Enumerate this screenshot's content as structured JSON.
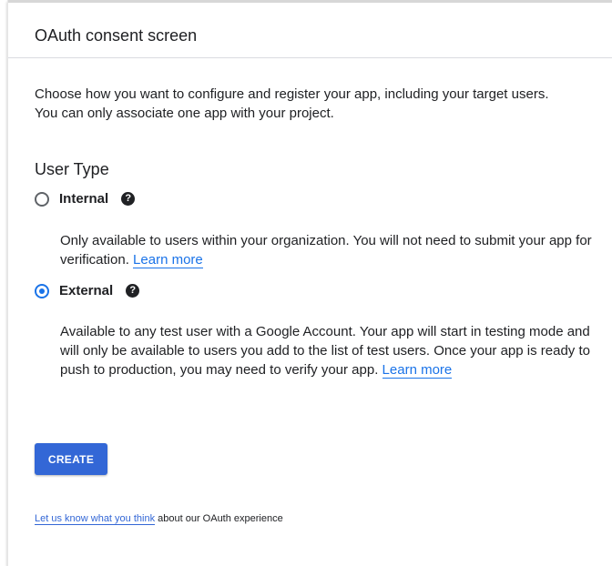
{
  "header": {
    "title": "OAuth consent screen"
  },
  "intro": "Choose how you want to configure and register your app, including your target users. You can only associate one app with your project.",
  "user_type": {
    "title": "User Type",
    "options": [
      {
        "label": "Internal",
        "checked": false,
        "help_icon": "help-circle-icon",
        "description": "Only available to users within your organization. You will not need to submit your app for verification.",
        "link": "Learn more"
      },
      {
        "label": "External",
        "checked": true,
        "help_icon": "help-circle-icon",
        "description": "Available to any test user with a Google Account. Your app will start in testing mode and will only be available to users you add to the list of test users. Once your app is ready to push to production, you may need to verify your app.",
        "link": "Learn more"
      }
    ]
  },
  "create_button": "CREATE",
  "feedback": {
    "link": "Let us know what you think",
    "text": " about our OAuth experience"
  },
  "colors": {
    "accent": "#1a73e8",
    "button": "#3367d6"
  }
}
